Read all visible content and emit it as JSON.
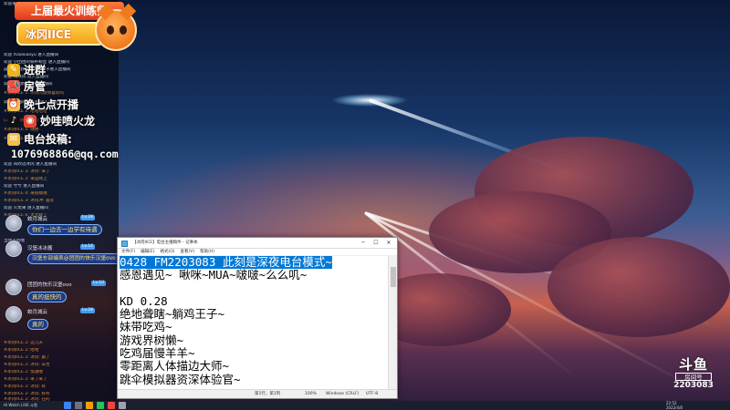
{
  "overlay": {
    "banner_title": "上届最火训练师",
    "banner_name": "冰冈IICE",
    "info_items": [
      {
        "label": "进群",
        "icon": "chat-bubble-icon"
      },
      {
        "label": "房管",
        "icon": "megaphone-icon"
      },
      {
        "label": "晚七点开播",
        "icon": "alarm-clock-icon"
      },
      {
        "label": "妙哇喷火龙",
        "icon": "weibo-icon"
      },
      {
        "label": "电台投稿:",
        "icon": "mailbox-icon"
      }
    ],
    "email": "1076968866@qq.com"
  },
  "chat_lines": [
    "欢迎来到【冰冈】的直播间",
    "欢迎 Xiaoxiaoyu 进入直播间",
    "欢迎 小团团的铁杆粉丝 进入直播间",
    "@对不起我们不能卡脖子进入直播间",
    "欢迎 蒋沐风 进入直播间",
    "欢迎 冰冈粉丝 进入直播间",
    "#冰冈IICE 3: 冰冈的歌你喜欢吗",
    "欢迎 对面的小可爱 进入直播间",
    "#冰冈IICE 2: 哈哈哈哈",
    "Lv.4#冰冈粉丝(1) 3: 赢不了也要投",
    "#冰冈IICE 5: 随便",
    "#冰冈IICE 4: 沃安一下等",
    "欢迎 风吹过冰冈 进入直播间",
    "#冰冈IICE 3: 冰冈: 来了",
    "#冰冈IICE 2: 来是晚上",
    "欢迎 兮兮 进入直播间",
    "#冰冈IICE 4: 来投稿哦",
    "#冰冈IICE 3: 冰冈冲: 喜欢",
    "欢迎 火龙果 进入直播间",
    "#冰冈IICE 6: 太无聊了",
    "当然以后哦",
    "#冰冈IICE 2: 这几天",
    "#冰冈IICE 2: 哈哈",
    "#冰冈IICE 2: 冰冈: 赢了",
    "#冰冈IICE 2: 冰冈: 辛苦",
    "#冰冈IICE 2: 加油哦",
    "#冰冈IICE 2: 来了来了",
    "#冰冈IICE 2: 冰冈: 好",
    "#冰冈IICE 2: 冰冈: 好听",
    "#冰冈IICE 2: 冰冈: 在的"
  ],
  "bubbles": [
    {
      "user": "蛟月城云",
      "badge": "Lv.28",
      "message": "你们一边去一边学有待遇"
    },
    {
      "user": "汉堡冰冰酱",
      "badge": "Lv.16",
      "message": "汉堡东部编表@团团的快乐汉堡ovo 投快的"
    },
    {
      "user": "团团的快乐汉堡ovo",
      "badge": "Lv.10",
      "message": "真的挺快的"
    },
    {
      "user": "蛟月城云",
      "badge": "Lv.28",
      "message": "真的"
    }
  ],
  "notepad": {
    "title": "【冰冈IICE】电台主播稿件 - 记事本",
    "menu": [
      "文件(F)",
      "编辑(E)",
      "格式(O)",
      "查看(V)",
      "帮助(H)"
    ],
    "selected_line": "0428 FM2203083 此刻是深夜电台模式~",
    "lines": [
      "感恩遇见~ 啾咪~MUA~啵啵~么么叽~",
      "",
      "KD 0.28",
      "绝地聋瞎~躺鸡王子~",
      "妹带吃鸡~",
      "游戏界树懒~",
      "吃鸡届慢羊羊~",
      "零距离人体描边大师~",
      "跳伞模拟器资深体验官~"
    ],
    "status": {
      "position": "第1行，第1列",
      "zoom": "100%",
      "eol": "Windows (CRLF)",
      "encoding": "UTF-8"
    }
  },
  "watermark": {
    "logo": "斗鱼",
    "label": "房间号",
    "number": "2203083"
  },
  "taskbar": {
    "app_label": "Hi Watch LIVE 斗鱼",
    "time": "22:52",
    "date": "2022/4/8"
  }
}
